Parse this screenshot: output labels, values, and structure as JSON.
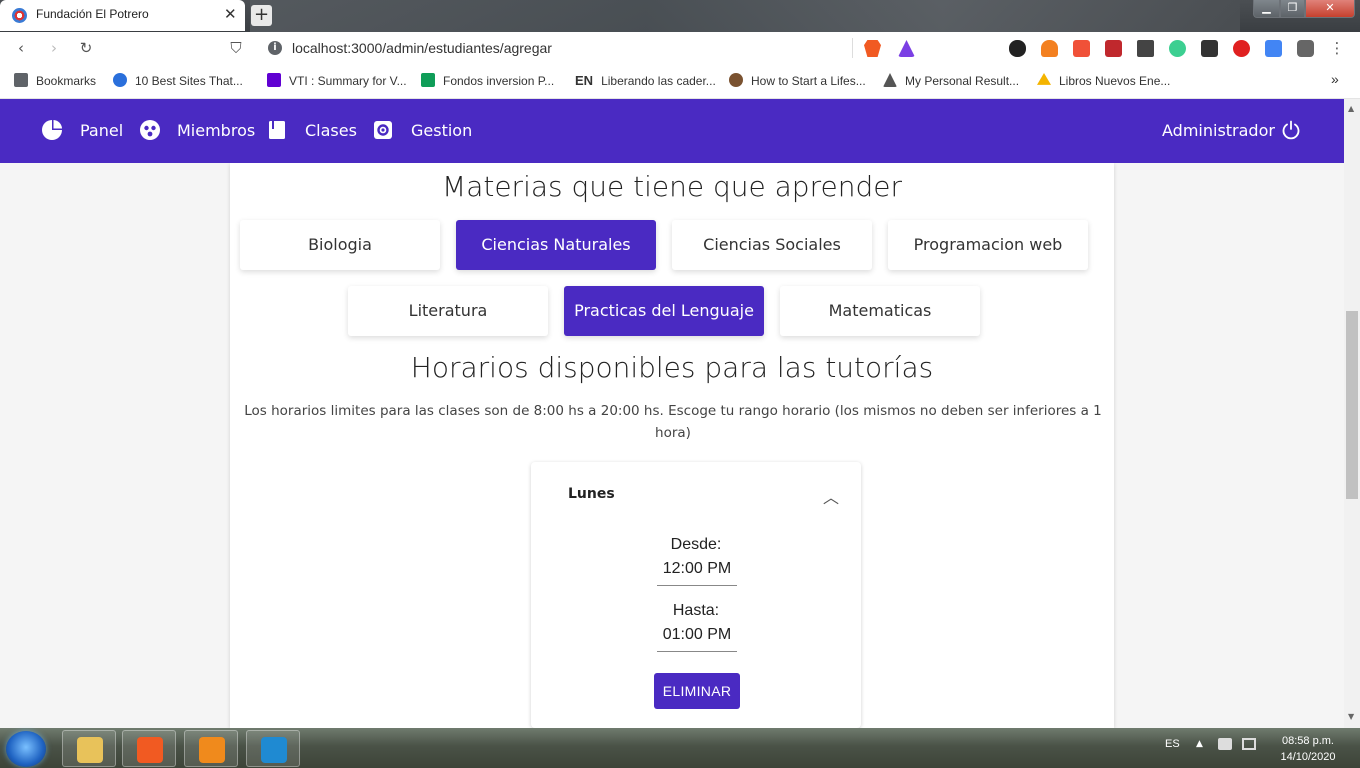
{
  "browser": {
    "tab_title": "Fundación El Potrero",
    "tab_close": "✕",
    "new_tab": "+",
    "url": "localhost:3000/admin/estudiantes/agregar",
    "bookmarks": [
      {
        "label": "Bookmarks",
        "color": "#5f6368"
      },
      {
        "label": "10 Best Sites That...",
        "color": "#2a6fdb"
      },
      {
        "label": "VTI : Summary for V...",
        "color": "#6001d2"
      },
      {
        "label": "Fondos inversion P...",
        "color": "#0f9d58"
      },
      {
        "label": "Liberando las cader...",
        "color": "#111111"
      },
      {
        "label": "How to Start a Lifes...",
        "color": "#7a5230"
      },
      {
        "label": "My Personal Result...",
        "color": "#555555"
      },
      {
        "label": "Libros Nuevos Ene...",
        "color": "#f4b400"
      }
    ],
    "bookmark_en": "EN",
    "more": "»"
  },
  "nav": {
    "items": [
      {
        "label": "Panel",
        "icon": "pie-chart-icon"
      },
      {
        "label": "Miembros",
        "icon": "group-icon"
      },
      {
        "label": "Clases",
        "icon": "book-icon"
      },
      {
        "label": "Gestion",
        "icon": "gear-icon"
      }
    ],
    "user_label": "Administrador",
    "power_icon": "power-icon"
  },
  "subjects": {
    "title": "Materias que tiene que aprender",
    "items": [
      {
        "label": "Biologia",
        "selected": false
      },
      {
        "label": "Ciencias Naturales",
        "selected": true
      },
      {
        "label": "Ciencias Sociales",
        "selected": false
      },
      {
        "label": "Programacion web",
        "selected": false
      },
      {
        "label": "Literatura",
        "selected": false
      },
      {
        "label": "Practicas del Lenguaje",
        "selected": true
      },
      {
        "label": "Matematicas",
        "selected": false
      }
    ]
  },
  "schedule": {
    "title": "Horarios disponibles para las tutorías",
    "description": "Los horarios limites para las clases son de 8:00 hs a 20:00 hs. Escoge tu rango horario (los mismos no deben ser inferiores a 1 hora)",
    "day": "Lunes",
    "from_label": "Desde:",
    "from_value": "12:00 PM",
    "to_label": "Hasta:",
    "to_value": "01:00 PM",
    "delete_label": "ELIMINAR"
  },
  "taskbar": {
    "lang": "ES",
    "time": "08:58 p.m.",
    "date": "14/10/2020"
  },
  "colors": {
    "accent": "#4a2ac2"
  }
}
